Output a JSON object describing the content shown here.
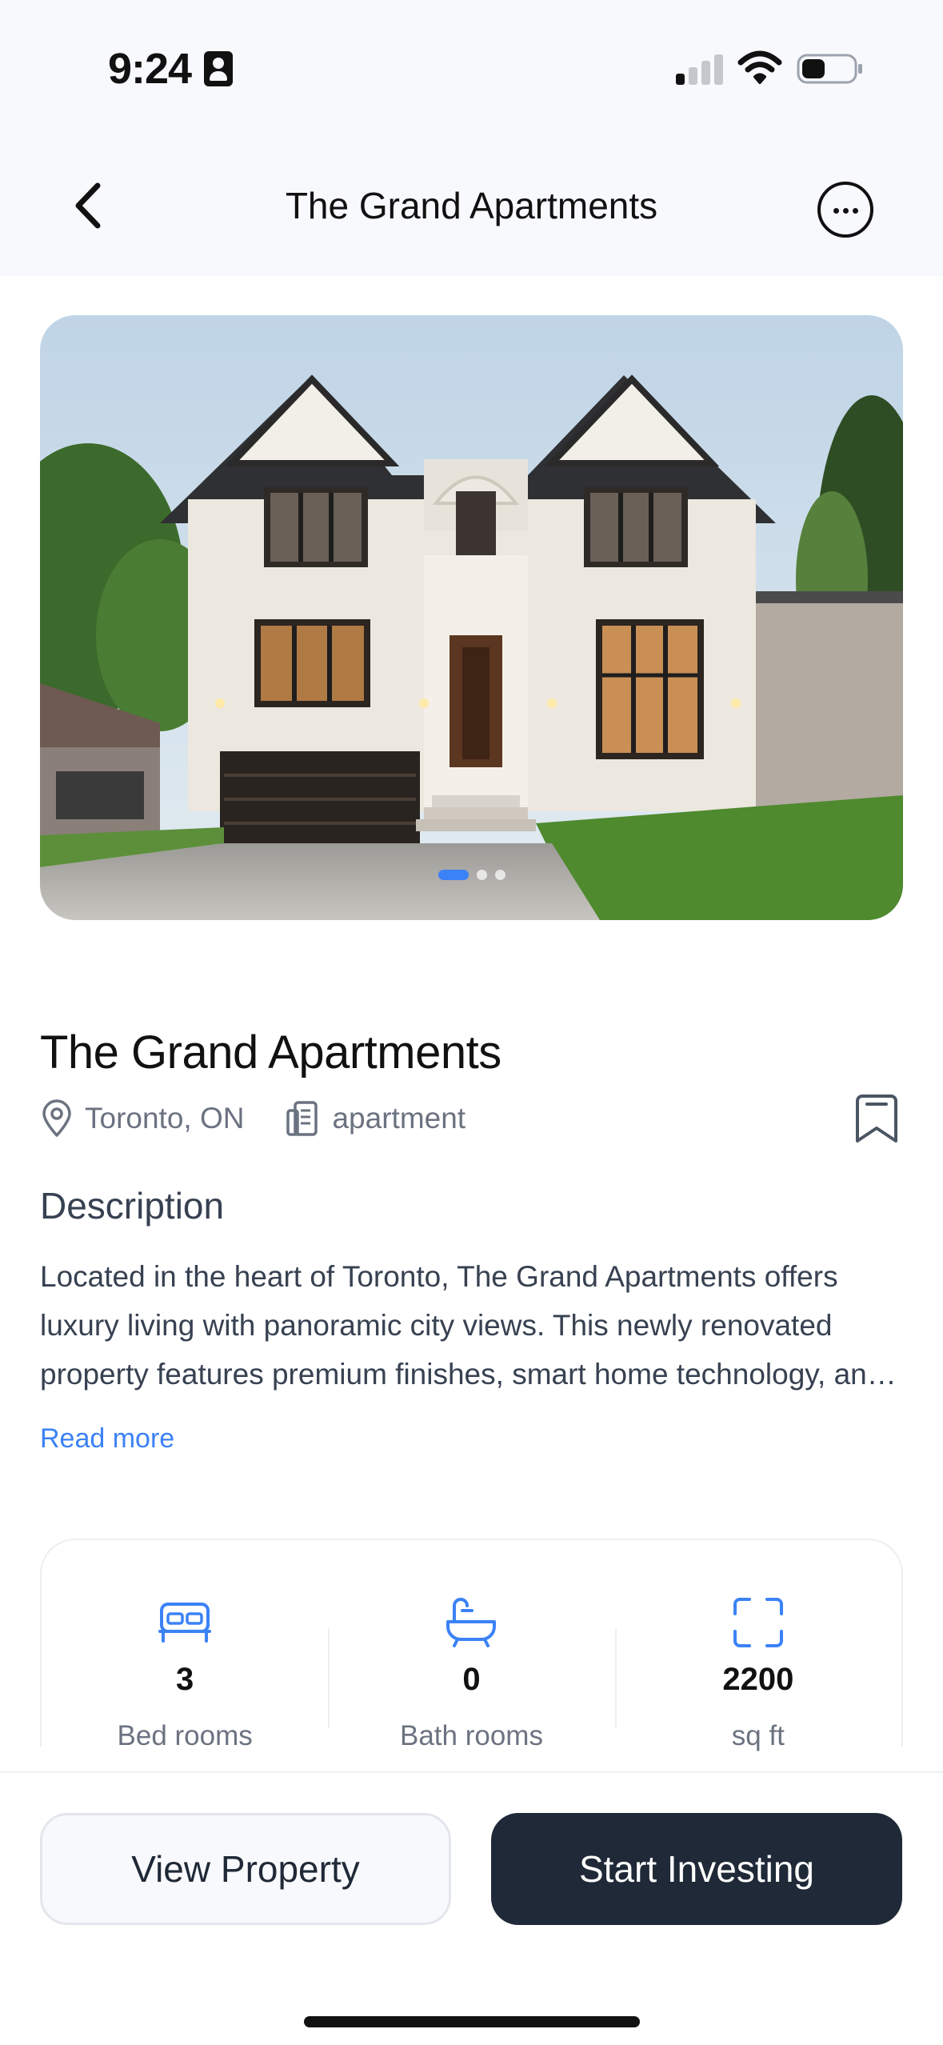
{
  "status_bar": {
    "time": "9:24",
    "icons": [
      "person-badge-icon",
      "cellular-signal-icon",
      "wifi-icon",
      "battery-icon"
    ]
  },
  "nav": {
    "title": "The Grand Apartments",
    "back_icon": "chevron-left-icon",
    "more_icon": "ellipsis-circle-icon"
  },
  "gallery": {
    "image_count": 3,
    "active_index": 0,
    "accent_color": "#3b82f6"
  },
  "property": {
    "title": "The Grand Apartments",
    "location": "Toronto, ON",
    "type": "apartment",
    "location_icon": "map-pin-icon",
    "type_icon": "building-icon",
    "bookmark_icon": "bookmark-icon"
  },
  "description": {
    "heading": "Description",
    "text": "Located in the heart of Toronto, The Grand Apartments offers luxury living with panoramic city views. This newly renovated property features premium finishes, smart home technology, and exclusive amenities for residents.",
    "read_more": "Read more"
  },
  "stats": [
    {
      "icon": "bed-icon",
      "value": "3",
      "label": "Bed rooms"
    },
    {
      "icon": "bathtub-icon",
      "value": "0",
      "label": "Bath rooms"
    },
    {
      "icon": "area-frame-icon",
      "value": "2200",
      "label": "sq ft"
    }
  ],
  "actions": {
    "view_property": "View Property",
    "start_investing": "Start Investing"
  },
  "colors": {
    "primary_dark": "#1f2937",
    "link": "#3b82f6",
    "background": "#f8f9fc"
  }
}
